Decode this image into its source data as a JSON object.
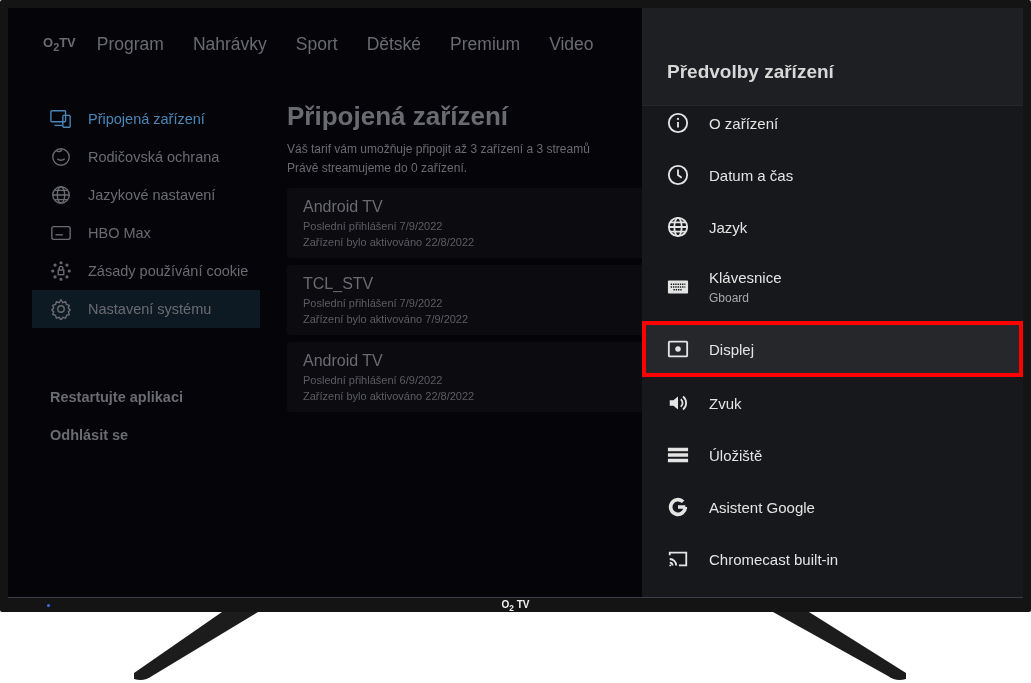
{
  "app": {
    "logo": "O$_{2}$TV",
    "nav": [
      {
        "label": "Program"
      },
      {
        "label": "Nahrávky"
      },
      {
        "label": "Sport"
      },
      {
        "label": "Dětské"
      },
      {
        "label": "Premium"
      },
      {
        "label": "Video"
      }
    ],
    "sidebar": {
      "items": [
        {
          "label": "Připojená zařízení",
          "kind": "devices",
          "selected": true,
          "focused": false
        },
        {
          "label": "Rodičovská ochrana",
          "kind": "face",
          "selected": false,
          "focused": false
        },
        {
          "label": "Jazykové nastavení",
          "kind": "globe",
          "selected": false,
          "focused": false
        },
        {
          "label": "HBO Max",
          "kind": "card",
          "selected": false,
          "focused": false
        },
        {
          "label": "Zásady používání cookie",
          "kind": "cookie",
          "selected": false,
          "focused": false
        },
        {
          "label": "Nastavení systému",
          "kind": "gear",
          "selected": false,
          "focused": true
        }
      ],
      "actions": [
        {
          "label": "Restartujte aplikaci"
        },
        {
          "label": "Odhlásit se"
        }
      ]
    },
    "page": {
      "title": "Připojená zařízení",
      "description": [
        "Váš tarif vám umožňuje připojit až 3 zařízení a 3 streamů",
        "Právě streamujeme do 0 zařízení."
      ],
      "devices": [
        {
          "name": "Android TV",
          "last_login": "Poslední přihlášení 7/9/2022",
          "activated": "Zařízení bylo aktivováno 22/8/2022"
        },
        {
          "name": "TCL_STV",
          "last_login": "Poslední přihlášení 7/9/2022",
          "activated": "Zařízení bylo aktivováno 7/9/2022"
        },
        {
          "name": "Android TV",
          "last_login": "Poslední přihlášení 6/9/2022",
          "activated": "Zařízení bylo aktivováno 22/8/2022"
        }
      ]
    }
  },
  "panel": {
    "title": "Předvolby zařízení",
    "items": [
      {
        "label": "O zařízení",
        "kind": "info",
        "highlighted": false
      },
      {
        "label": "Datum a čas",
        "kind": "clock",
        "highlighted": false
      },
      {
        "label": "Jazyk",
        "kind": "globe",
        "highlighted": false
      },
      {
        "label": "Klávesnice",
        "sublabel": "Gboard",
        "kind": "keyboard",
        "highlighted": false
      },
      {
        "label": "Displej",
        "kind": "display",
        "highlighted": true
      },
      {
        "label": "Zvuk",
        "kind": "speaker",
        "highlighted": false
      },
      {
        "label": "Úložiště",
        "kind": "storage",
        "highlighted": false
      },
      {
        "label": "Asistent Google",
        "kind": "google",
        "highlighted": false
      },
      {
        "label": "Chromecast built-in",
        "kind": "cast",
        "highlighted": false
      }
    ]
  },
  "tv": {
    "brand": "O$_{2}$ TV"
  }
}
